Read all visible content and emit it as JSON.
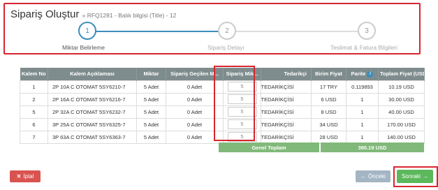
{
  "header": {
    "title": "Sipariş Oluştur",
    "subtitle": "» RFQ1281 - Balık bilgisi (Title) - 12"
  },
  "steps": [
    {
      "number": "1",
      "label": "Miktar Belirleme",
      "active": true
    },
    {
      "number": "2",
      "label": "Sipariş Detayı",
      "active": false
    },
    {
      "number": "3",
      "label": "Teslimat & Fatura Bilgileri",
      "active": false
    }
  ],
  "table": {
    "columns": [
      "Kalem No",
      "Kalem Açıklaması",
      "Miktar",
      "Sipariş Geçilen M...",
      "Sipariş Mik...",
      "Tedarikçi",
      "Birim Fiyat",
      "Parite",
      "Toplam Fiyat (USD)"
    ],
    "parite_icon": "info-icon",
    "rows": [
      {
        "kalem_no": "1",
        "aciklama": "2P 10A C OTOMAT 5SY6210-7",
        "miktar": "5 Adet",
        "gecilen": "0 Adet",
        "siparis_miktar": "5",
        "tedarikci": "A TEDARİKÇİSİ",
        "birim_fiyat": "17 TRY",
        "parite": "0.119893",
        "toplam": "10.19 USD"
      },
      {
        "kalem_no": "2",
        "aciklama": "2P 16A C OTOMAT 5SY6216-7",
        "miktar": "5 Adet",
        "gecilen": "0 Adet",
        "siparis_miktar": "5",
        "tedarikci": "A TEDARİKÇİSİ",
        "birim_fiyat": "6 USD",
        "parite": "1",
        "toplam": "30.00 USD"
      },
      {
        "kalem_no": "5",
        "aciklama": "2P 32A C OTOMAT 5SY6232-7",
        "miktar": "5 Adet",
        "gecilen": "0 Adet",
        "siparis_miktar": "5",
        "tedarikci": "A TEDARİKÇİSİ",
        "birim_fiyat": "8 USD",
        "parite": "1",
        "toplam": "40.00 USD"
      },
      {
        "kalem_no": "6",
        "aciklama": "3P 25A C OTOMAT 5SY6325-7",
        "miktar": "5 Adet",
        "gecilen": "0 Adet",
        "siparis_miktar": "5",
        "tedarikci": "A TEDARİKÇİSİ",
        "birim_fiyat": "34 USD",
        "parite": "1",
        "toplam": "170.00 USD"
      },
      {
        "kalem_no": "7",
        "aciklama": "3P 63A C OTOMAT 5SY6363-7",
        "miktar": "5 Adet",
        "gecilen": "0 Adet",
        "siparis_miktar": "5",
        "tedarikci": "A TEDARİKÇİSİ",
        "birim_fiyat": "28 USD",
        "parite": "1",
        "toplam": "140.00 USD"
      }
    ]
  },
  "totals": {
    "label": "Genel Toplam",
    "value": "390.19 USD"
  },
  "buttons": {
    "cancel": "İptal",
    "prev": "Önceki",
    "next": "Sonraki"
  },
  "colors": {
    "highlight": "#d7262e",
    "accent": "#3c8dbc",
    "total_bg": "#81b97a",
    "header_bg": "#7f8c8d",
    "cancel": "#d9534f",
    "next": "#5cb85c",
    "prev": "#a4b5c4"
  }
}
